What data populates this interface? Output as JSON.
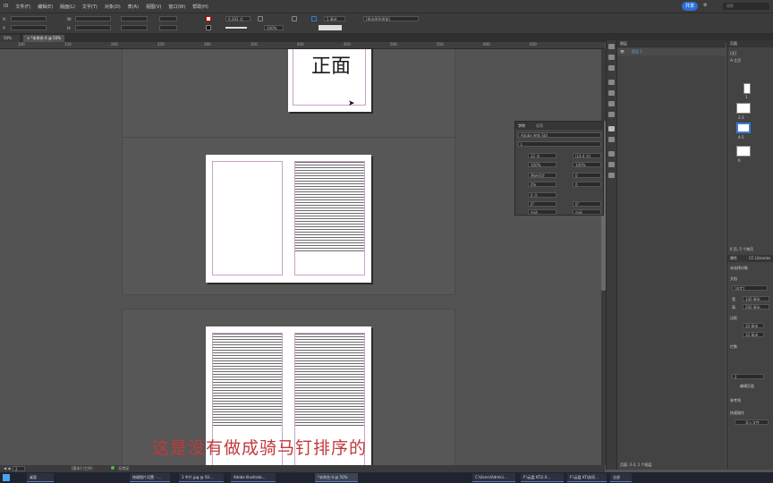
{
  "menubar": {
    "items": [
      "ID",
      "文件(F)",
      "编辑(E)",
      "版面(L)",
      "文字(T)",
      "对象(O)",
      "表(A)",
      "视图(V)",
      "窗口(W)",
      "帮助(H)"
    ],
    "share": "共享",
    "search_placeholder": "搜索"
  },
  "control": {
    "x_label": "X:",
    "y_label": "Y:",
    "w_label": "W:",
    "h_label": "H:",
    "stroke_weight": "0.283 点",
    "gap": "5 毫米",
    "zoom_pct": "100%",
    "style_dropdown": "[基本图形框架]"
  },
  "doc_tab": {
    "label": "*未命名-4 @ 50%",
    "close": "×"
  },
  "ruler_ticks": [
    "100",
    "150",
    "200",
    "250",
    "300",
    "350",
    "400",
    "450",
    "500",
    "550",
    "600",
    "650"
  ],
  "canvas": {
    "front_text": "正面",
    "subtitle": "这是没有做成骑马钉排序的"
  },
  "character_panel": {
    "tab_char": "字符",
    "tab_para": "段落",
    "font": "Adobe 宋体 Std",
    "style": "L",
    "size": "12 点",
    "leading": "(14.4 点)",
    "vscale": "100%",
    "hscale": "100%",
    "kerning": "原始设定",
    "tracking": "0",
    "tsume": "0%",
    "grid": "0",
    "baseline": "0 点",
    "skew": "0°",
    "rotate": "0°",
    "auto1": "自动",
    "auto2": "自动"
  },
  "layers": {
    "title": "图层",
    "layer1": "图层 1",
    "footer": "页面: 2-3, 1 个图层"
  },
  "pages_panel": {
    "title": "页面",
    "none": "[无]",
    "master": "A-主页",
    "pages": [
      "1",
      "2-3",
      "4-5",
      "6"
    ],
    "footer": "6 页, 5 个跨页",
    "props_tab": "属性",
    "cc_tab": "CC Libraries",
    "no_sel": "未选择对象",
    "doc": "文档",
    "preset": "[自定]",
    "width_lbl": "宽",
    "width": "140 毫米",
    "height_lbl": "高",
    "height": "200 毫米",
    "margins": "边距",
    "m1": "10 毫米",
    "m2": "10 毫米",
    "columns": "栏数",
    "col_val": "2",
    "edit": "编辑页面",
    "guides": "参考线",
    "quick": "快速操作",
    "import": "导入文件"
  },
  "status": {
    "page": "2",
    "mode": "[基本] (工作)",
    "errors": "无错误"
  },
  "taskbar": {
    "items": [
      "桌面",
      "按键图片设置 - ...",
      "1 中片.jpg @ 50...",
      "Adobe Illustrato...",
      "*未命名-4 @ 50%",
      "C:\\Users\\Admini...",
      "F:\\云盘 KT\\2.0...",
      "F:\\云盘 KT\\选项...",
      "全部"
    ]
  }
}
